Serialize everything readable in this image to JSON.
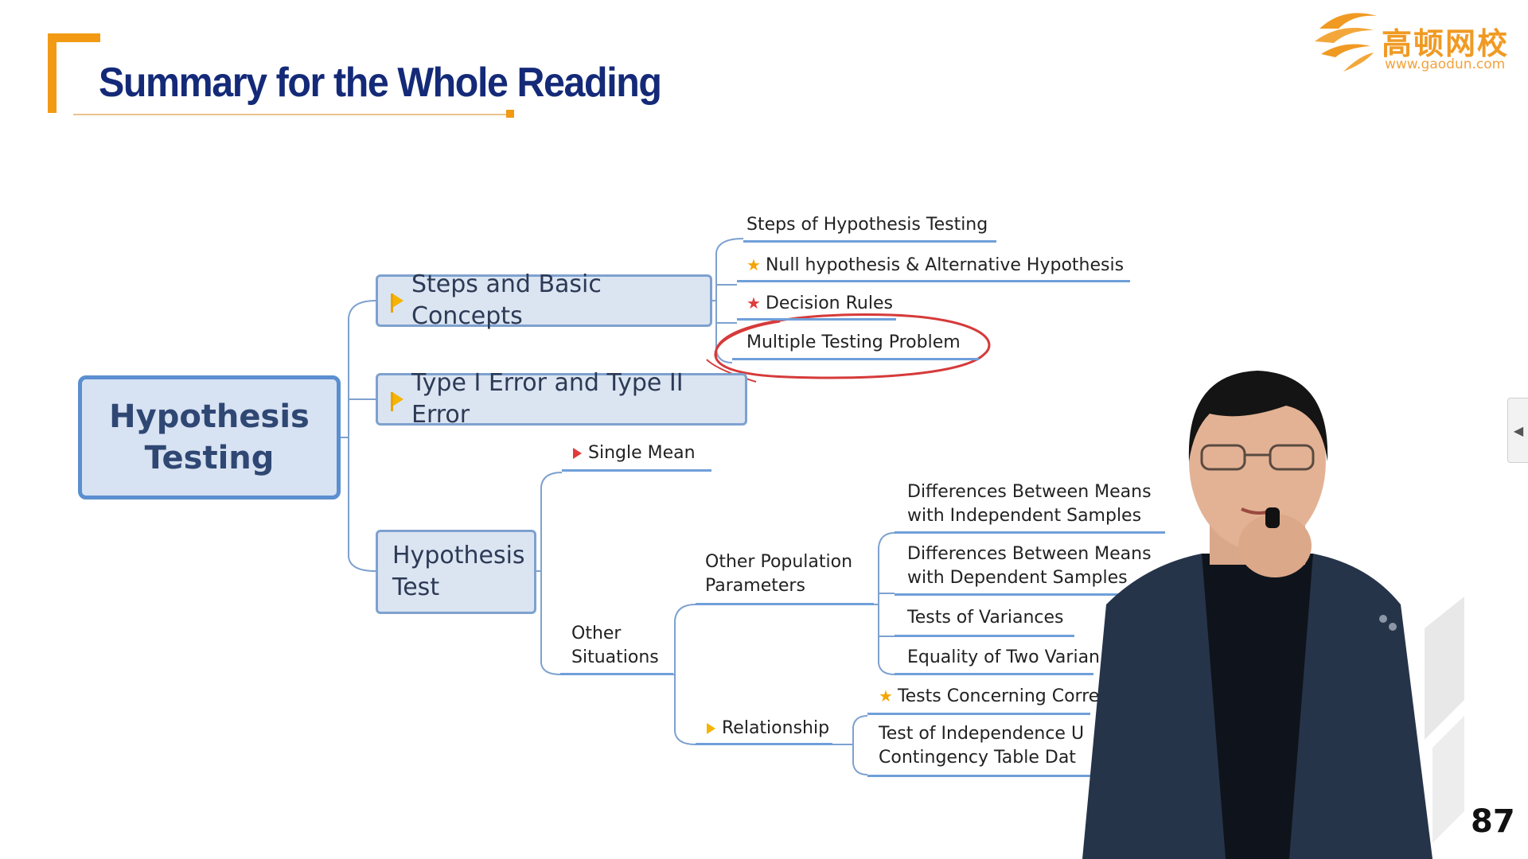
{
  "slide": {
    "title": "Summary for the Whole Reading",
    "page_number": "87"
  },
  "logo": {
    "name": "高顿网校",
    "url": "www.gaodun.com"
  },
  "mindmap": {
    "root": "Hypothesis Testing",
    "branches": [
      {
        "label": "Steps and Basic Concepts",
        "children": [
          "Steps of Hypothesis Testing",
          "Null hypothesis & Alternative Hypothesis",
          "Decision Rules",
          "Multiple Testing Problem"
        ]
      },
      {
        "label": "Type I Error and Type II Error"
      },
      {
        "label": "Hypothesis Test",
        "children": [
          "Single Mean",
          "Other Situations"
        ]
      }
    ],
    "other_situations": {
      "other_population_parameters": "Other Population Parameters",
      "opp_children": [
        "Differences Between Means with Independent Samples",
        "Differences Between Means with Dependent Samples",
        "Tests of Variances",
        "Equality of Two Varian"
      ],
      "relationship": "Relationship",
      "rel_children": [
        "Tests Concerning Corre",
        "Test of Independence U Contingency Table Dat"
      ]
    }
  },
  "colors": {
    "accent_orange": "#f29a14",
    "title_navy": "#142a78",
    "node_fill": "#dbe4f1",
    "node_border": "#7ea1cf",
    "annotation_red": "#d63a3a"
  }
}
